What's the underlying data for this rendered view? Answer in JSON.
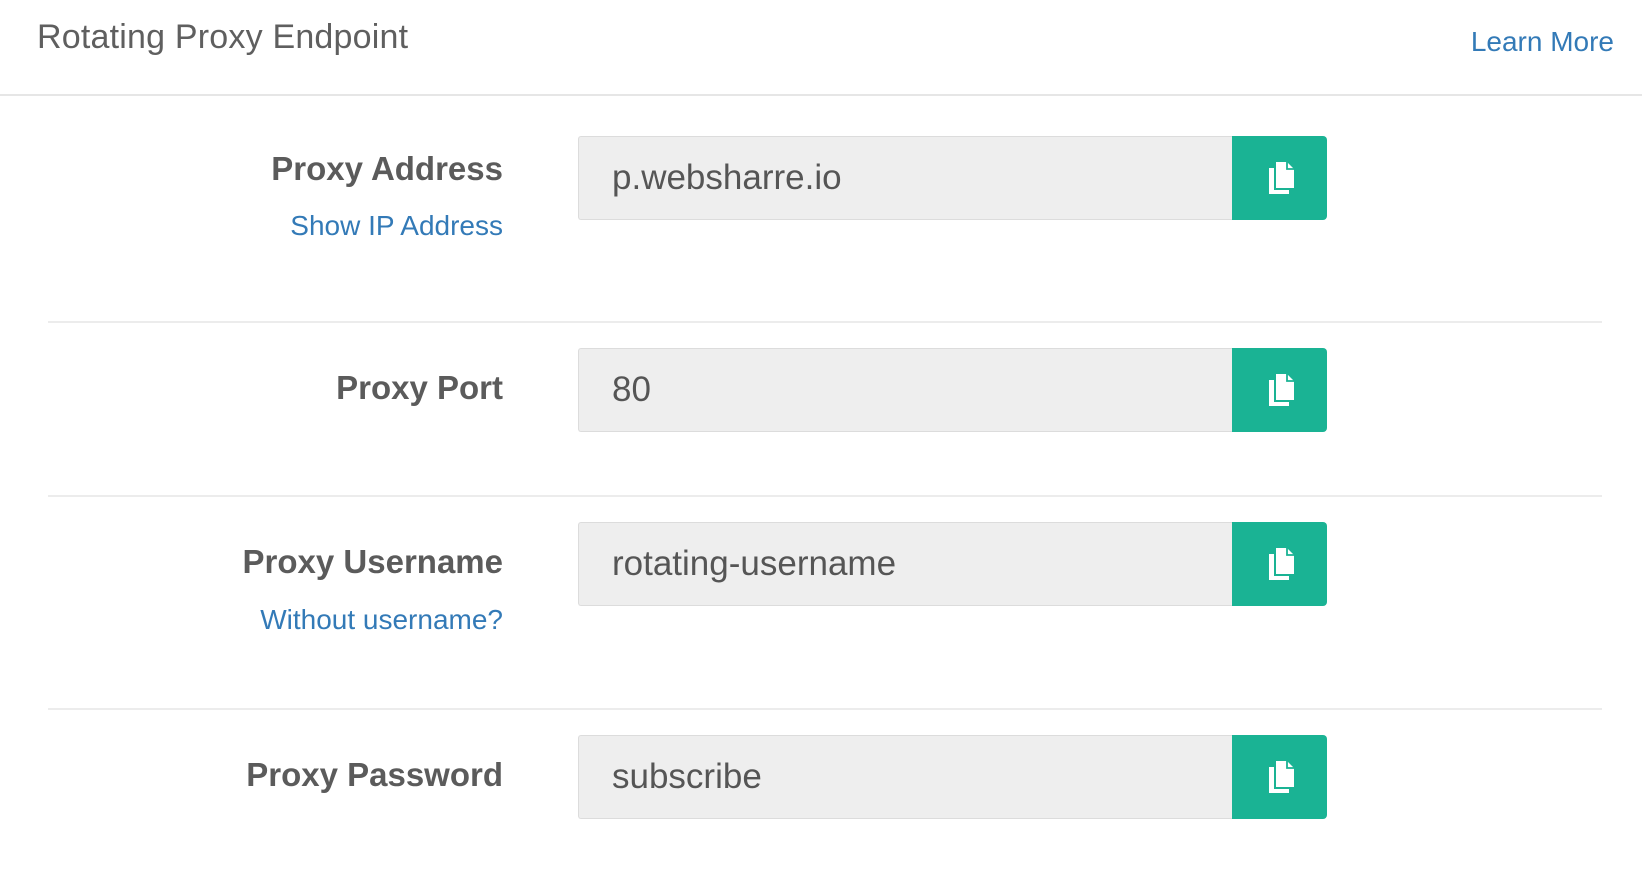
{
  "header": {
    "title": "Rotating Proxy Endpoint",
    "learn_more": "Learn More"
  },
  "fields": [
    {
      "label": "Proxy Address",
      "value": "p.websharre.io",
      "sublink": "Show IP Address",
      "copy_icon": "copy-icon"
    },
    {
      "label": "Proxy Port",
      "value": "80",
      "copy_icon": "copy-icon"
    },
    {
      "label": "Proxy Username",
      "value": "rotating-username",
      "sublink": "Without username?",
      "copy_icon": "copy-icon"
    },
    {
      "label": "Proxy Password",
      "value": "subscribe",
      "copy_icon": "copy-icon"
    }
  ],
  "colors": {
    "accent": "#1ab394",
    "link": "#337ab7",
    "field_bg": "#eeeeee",
    "label": "#5b5b5b"
  }
}
